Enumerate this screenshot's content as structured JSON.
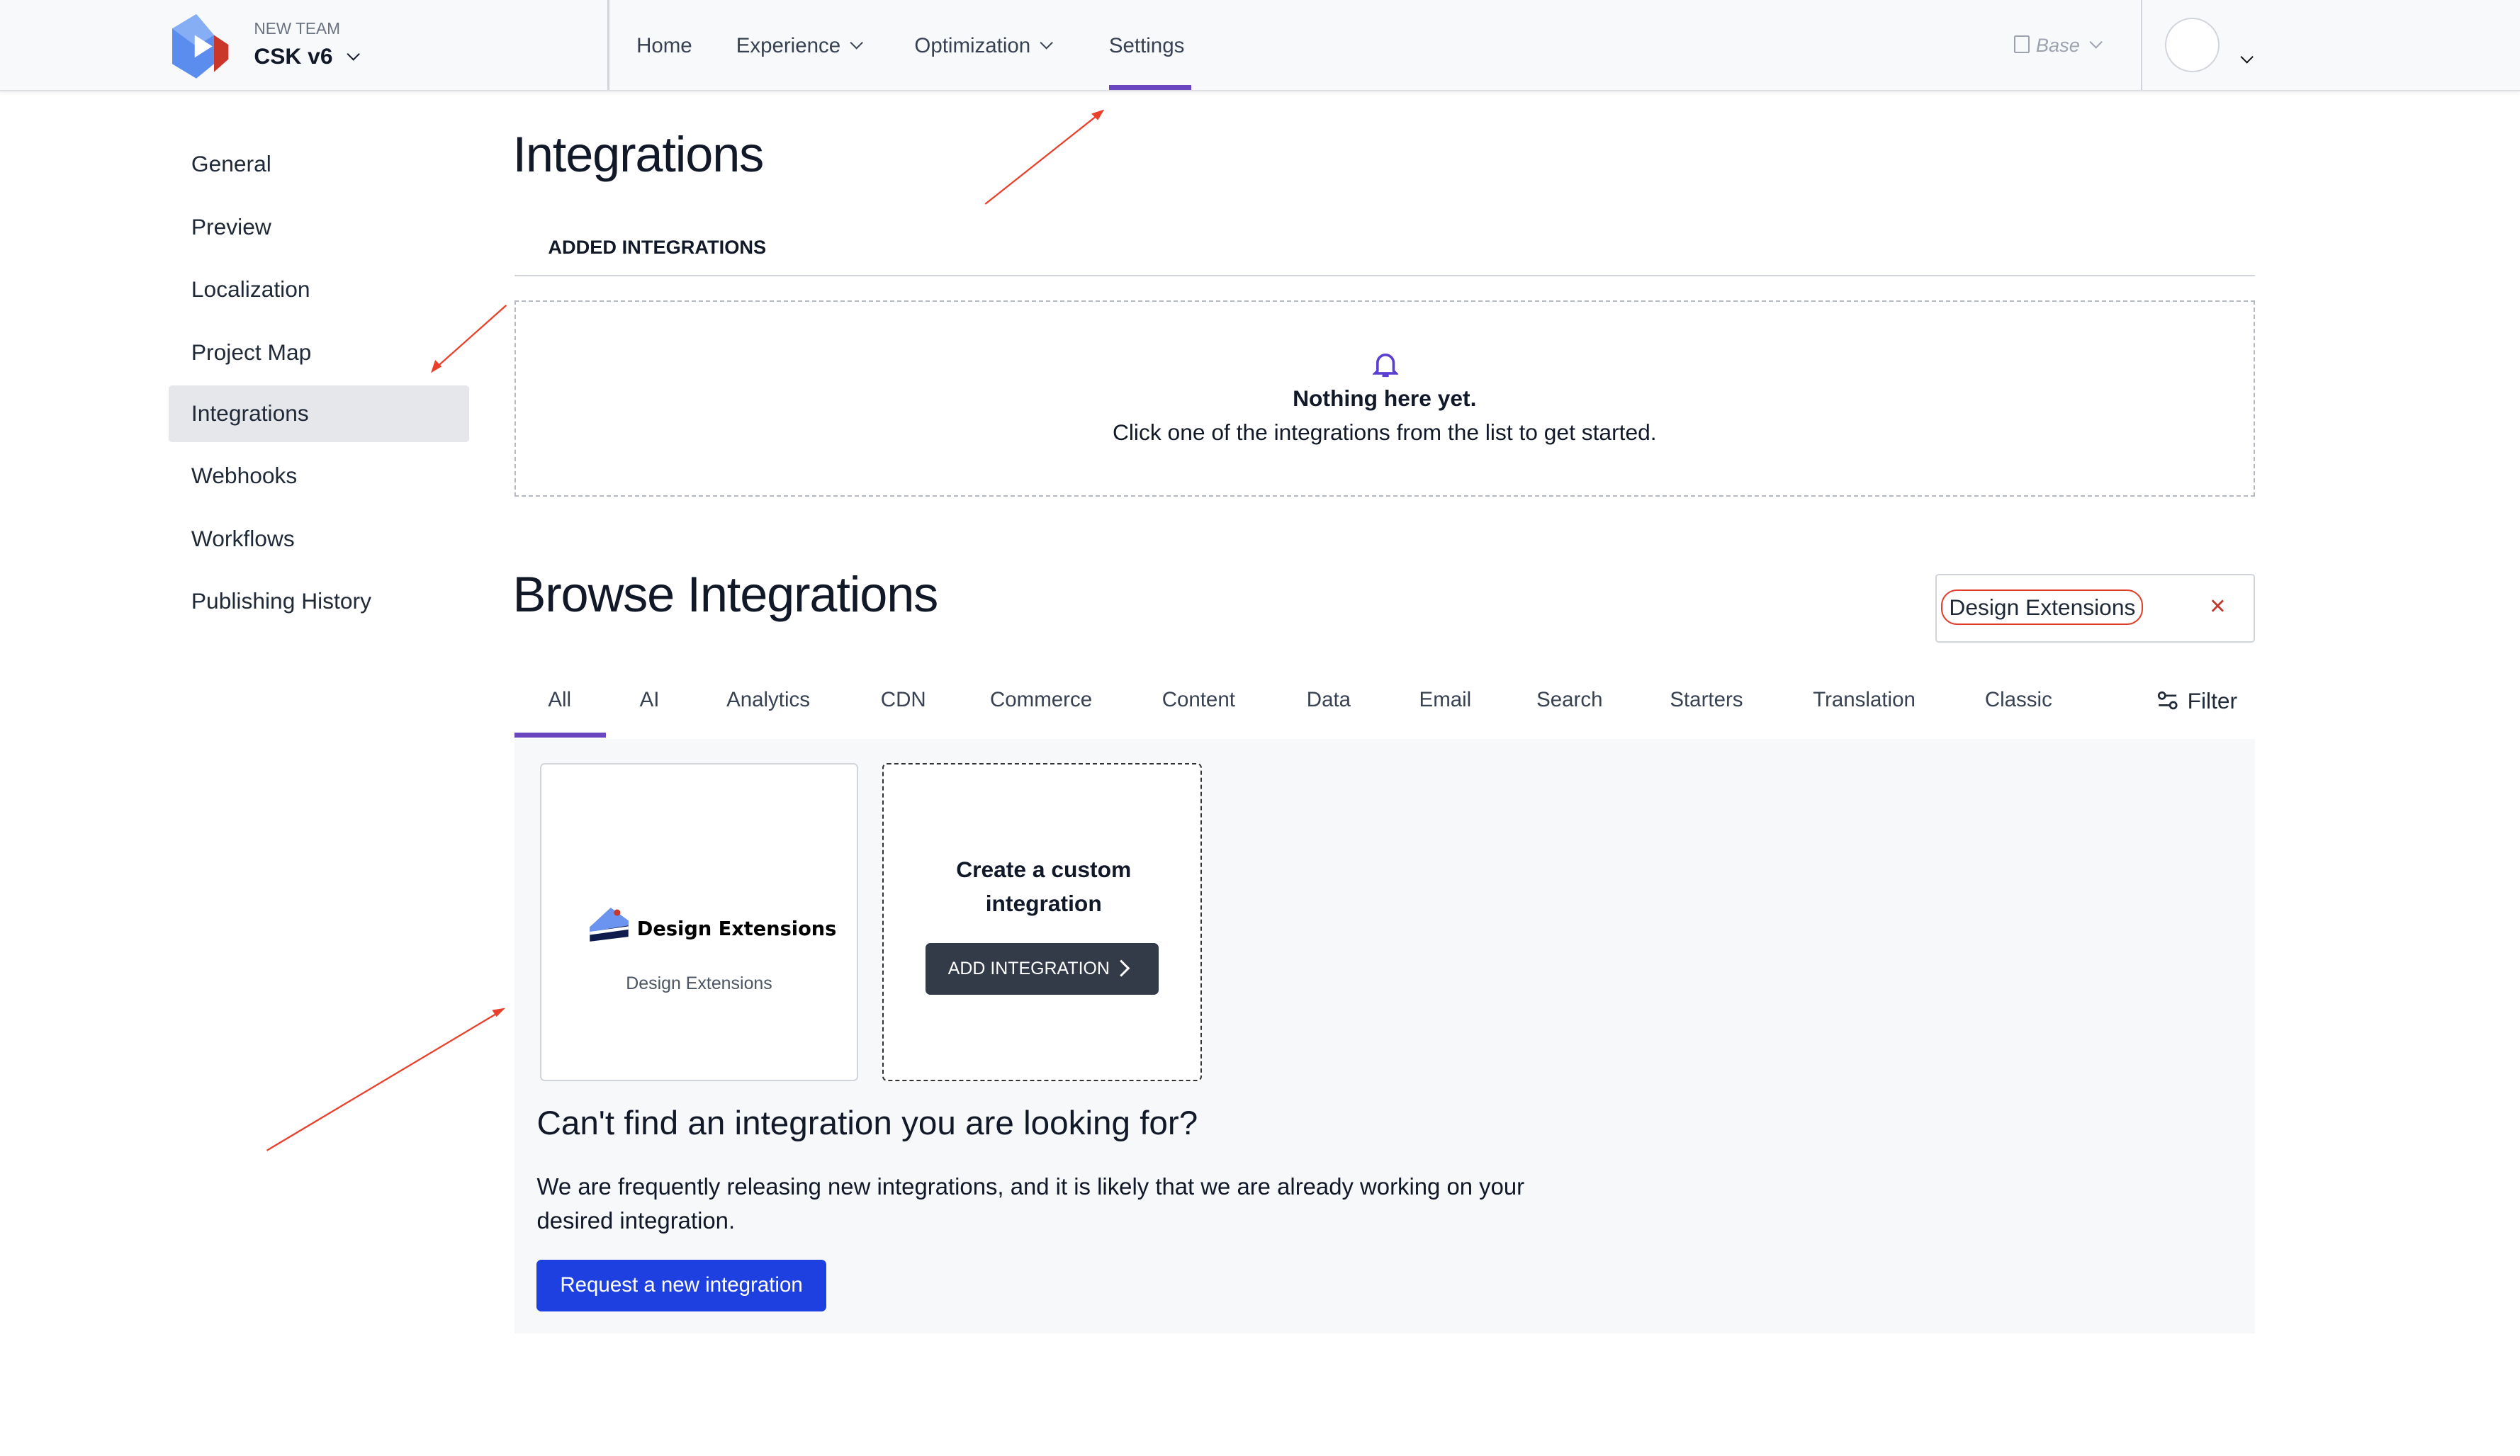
{
  "header": {
    "team_label": "NEW TEAM",
    "project_name": "CSK v6",
    "nav": [
      {
        "label": "Home"
      },
      {
        "label": "Experience"
      },
      {
        "label": "Optimization"
      },
      {
        "label": "Settings"
      }
    ],
    "environment": "Base",
    "accent_color": "#6b46c1"
  },
  "sidebar": {
    "items": [
      {
        "label": "General"
      },
      {
        "label": "Preview"
      },
      {
        "label": "Localization"
      },
      {
        "label": "Project Map"
      },
      {
        "label": "Integrations",
        "active": true
      },
      {
        "label": "Webhooks"
      },
      {
        "label": "Workflows"
      },
      {
        "label": "Publishing History"
      }
    ]
  },
  "main": {
    "title": "Integrations",
    "added_heading": "ADDED INTEGRATIONS",
    "empty_title": "Nothing here yet.",
    "empty_text": "Click one of the integrations from the list to get started.",
    "browse_title": "Browse Integrations",
    "search_value": "Design Extensions",
    "tabs": [
      {
        "label": "All"
      },
      {
        "label": "AI"
      },
      {
        "label": "Analytics"
      },
      {
        "label": "CDN"
      },
      {
        "label": "Commerce"
      },
      {
        "label": "Content"
      },
      {
        "label": "Data"
      },
      {
        "label": "Email"
      },
      {
        "label": "Search"
      },
      {
        "label": "Starters"
      },
      {
        "label": "Translation"
      },
      {
        "label": "Classic"
      }
    ],
    "filter_label": "Filter",
    "integration_card": {
      "logo_text": "Design Extensions",
      "name": "Design Extensions"
    },
    "custom_card": {
      "title": "Create a custom integration",
      "button": "ADD INTEGRATION"
    },
    "cant_find_title": "Can't find an integration you are looking for?",
    "cant_find_text": "We are frequently releasing new integrations, and it is likely that we are already working on your desired integration.",
    "request_button": "Request a new integration",
    "request_button_color": "#1e40e0"
  }
}
